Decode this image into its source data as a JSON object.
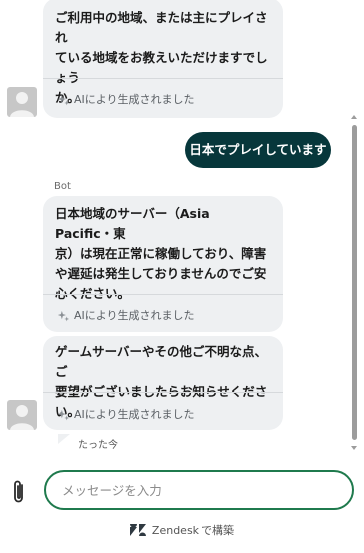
{
  "messages": {
    "bot1": {
      "lines": [
        "ご利用中の地域、または主にプレイされ",
        "ている地域をお教えいただけますでしょう",
        "か。"
      ],
      "ai_label": "AIにより生成されました"
    },
    "user1": {
      "text": "日本でプレイしています"
    },
    "sender_name": "Bot",
    "bot2": {
      "lines": [
        "日本地域のサーバー（Asia Pacific・東",
        "京）は現在正常に稼働しており、障害",
        "や遅延は発生しておりませんのでご安",
        "心ください。"
      ],
      "ai_label": "AIにより生成されました"
    },
    "bot3": {
      "lines": [
        "ゲームサーバーやその他ご不明な点、ご",
        "要望がございましたらお知らせください。"
      ],
      "ai_label": "AIにより生成されました"
    },
    "timestamp": "たった今"
  },
  "composer": {
    "placeholder": "メッセージを入力",
    "attach_icon": "paperclip-icon"
  },
  "footer": {
    "brand": "Zendesk",
    "suffix": "で構築"
  },
  "colors": {
    "accent": "#07373b",
    "input_border": "#1f7a4d",
    "bubble_bg": "#eef0f2"
  }
}
